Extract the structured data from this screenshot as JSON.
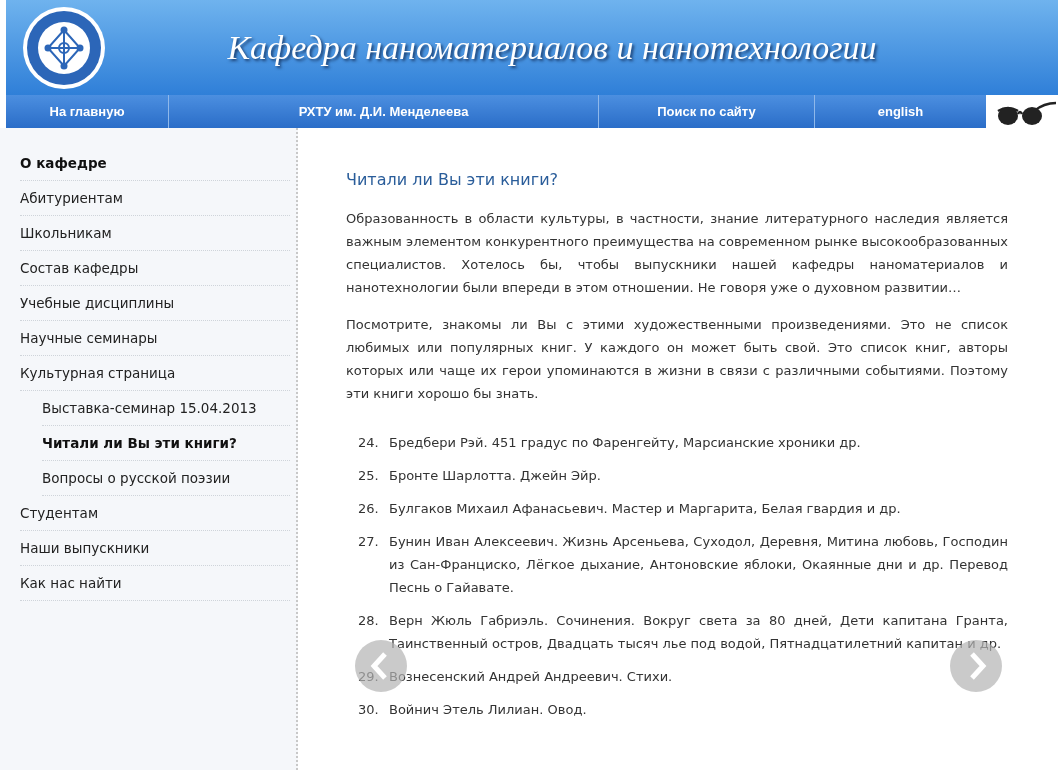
{
  "header": {
    "title": "Кафедра наноматериалов и нанотехнологии"
  },
  "nav": [
    {
      "label": "На главную"
    },
    {
      "label": "РХТУ им. Д.И. Менделеева"
    },
    {
      "label": "Поиск по сайту"
    },
    {
      "label": "english"
    }
  ],
  "sidebar": {
    "items": [
      {
        "label": "О кафедре",
        "selected": true
      },
      {
        "label": "Абитуриентам",
        "selected": false
      },
      {
        "label": "Школьникам",
        "selected": false
      },
      {
        "label": "Состав кафедры",
        "selected": false
      },
      {
        "label": "Учебные дисциплины",
        "selected": false
      },
      {
        "label": "Научные семинары",
        "selected": false
      },
      {
        "label": "Культурная страница",
        "selected": false,
        "children": [
          {
            "label": "Выставка-семинар 15.04.2013",
            "selected": false
          },
          {
            "label": "Читали ли Вы эти книги?",
            "selected": true
          },
          {
            "label": "Вопросы о русской поэзии",
            "selected": false
          }
        ]
      },
      {
        "label": "Студентам",
        "selected": false
      },
      {
        "label": "Наши выпускники",
        "selected": false
      },
      {
        "label": "Как нас найти",
        "selected": false
      }
    ]
  },
  "content": {
    "heading": "Читали ли Вы эти книги?",
    "paragraphs": [
      "Образованность в области культуры, в частности, знание литературного наследия является важным элементом конкурентного преимущества на современном рынке высокообразованных специалистов. Хотелось бы, чтобы выпускники нашей кафедры наноматериалов и нанотехнологии были впереди в этом отношении. Не говоря уже о духовном развитии…",
      "Посмотрите, знакомы ли Вы с этими художественными произведениями. Это не список любимых или популярных книг. У каждого он может быть свой. Это список книг, авторы которых или чаще их герои упоминаются в жизни в связи с различными событиями. Поэтому эти книги хорошо бы знать."
    ],
    "books": [
      {
        "number": "24.",
        "text": "Бредбери Рэй. 451 градус по Фаренгейту, Марсианские хроники др."
      },
      {
        "number": "25.",
        "text": "Бронте Шарлотта. Джейн Эйр."
      },
      {
        "number": "26.",
        "text": "Булгаков Михаил Афанасьевич. Мастер и Маргарита, Белая гвардия и др."
      },
      {
        "number": "27.",
        "text": "Бунин Иван Алексеевич. Жизнь Арсеньева, Суходол, Деревня, Митина любовь, Господин из Сан-Франциско, Лёгкое дыхание, Антоновские яблоки, Окаянные дни и др. Перевод Песнь о Гайавате."
      },
      {
        "number": "28.",
        "text": "Верн Жюль Габриэль. Сочинения. Вокруг света за 80 дней, Дети капитана Гранта, Таинственный остров, Двадцать тысяч лье под водой, Пятнадцатилетний капитан и др."
      },
      {
        "number": "29.",
        "text": "Вознесенский Андрей Андреевич. Стихи."
      },
      {
        "number": "30.",
        "text": "Войнич Этель Лилиан. Овод."
      }
    ]
  }
}
